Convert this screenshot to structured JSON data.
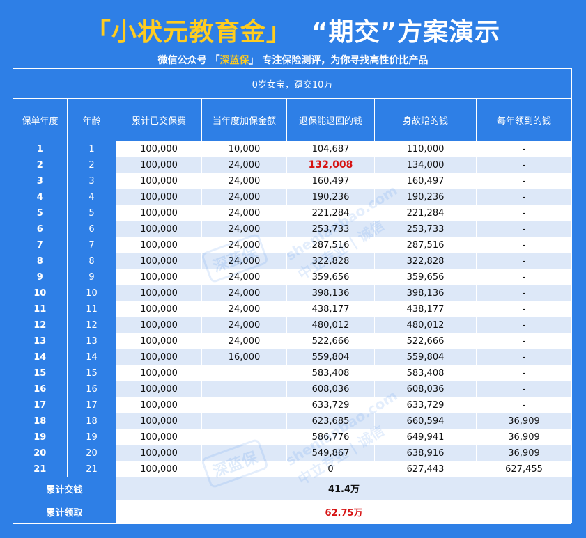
{
  "header": {
    "title_open": "「",
    "title_brand": "小状元教育金",
    "title_close": "」",
    "title_rest": "“期交”方案演示",
    "subtitle_prefix": "微信公众号 「",
    "subtitle_highlight": "深蓝保",
    "subtitle_suffix": "」 专注保险测评，为你寻找高性价比产品"
  },
  "table": {
    "caption": "0岁女宝，趸交10万",
    "columns": [
      "保单年度",
      "年龄",
      "累计已交保费",
      "当年度加保金额",
      "退保能退回的钱",
      "身故赔的钱",
      "每年领到的钱"
    ],
    "rows": [
      [
        "1",
        "1",
        "100,000",
        "10,000",
        "104,687",
        "110,000",
        "-"
      ],
      [
        "2",
        "2",
        "100,000",
        "24,000",
        "132,008",
        "134,000",
        "-"
      ],
      [
        "3",
        "3",
        "100,000",
        "24,000",
        "160,497",
        "160,497",
        "-"
      ],
      [
        "4",
        "4",
        "100,000",
        "24,000",
        "190,236",
        "190,236",
        "-"
      ],
      [
        "5",
        "5",
        "100,000",
        "24,000",
        "221,284",
        "221,284",
        "-"
      ],
      [
        "6",
        "6",
        "100,000",
        "24,000",
        "253,733",
        "253,733",
        "-"
      ],
      [
        "7",
        "7",
        "100,000",
        "24,000",
        "287,516",
        "287,516",
        "-"
      ],
      [
        "8",
        "8",
        "100,000",
        "24,000",
        "322,828",
        "322,828",
        "-"
      ],
      [
        "9",
        "9",
        "100,000",
        "24,000",
        "359,656",
        "359,656",
        "-"
      ],
      [
        "10",
        "10",
        "100,000",
        "24,000",
        "398,136",
        "398,136",
        "-"
      ],
      [
        "11",
        "11",
        "100,000",
        "24,000",
        "438,177",
        "438,177",
        "-"
      ],
      [
        "12",
        "12",
        "100,000",
        "24,000",
        "480,012",
        "480,012",
        "-"
      ],
      [
        "13",
        "13",
        "100,000",
        "24,000",
        "522,666",
        "522,666",
        "-"
      ],
      [
        "14",
        "14",
        "100,000",
        "16,000",
        "559,804",
        "559,804",
        "-"
      ],
      [
        "15",
        "15",
        "100,000",
        "",
        "583,408",
        "583,408",
        "-"
      ],
      [
        "16",
        "16",
        "100,000",
        "",
        "608,036",
        "608,036",
        "-"
      ],
      [
        "17",
        "17",
        "100,000",
        "",
        "633,729",
        "633,729",
        "-"
      ],
      [
        "18",
        "18",
        "100,000",
        "",
        "623,685",
        "660,594",
        "36,909"
      ],
      [
        "19",
        "19",
        "100,000",
        "",
        "586,776",
        "649,941",
        "36,909"
      ],
      [
        "20",
        "20",
        "100,000",
        "",
        "549,867",
        "638,916",
        "36,909"
      ],
      [
        "21",
        "21",
        "100,000",
        "",
        "0",
        "627,443",
        "627,455"
      ]
    ],
    "highlight_cell": {
      "row": 1,
      "col": 4,
      "color": "#d61212"
    },
    "summary": [
      {
        "label": "累计交钱",
        "value": "41.4万"
      },
      {
        "label": "累计领取",
        "value": "62.75万"
      }
    ]
  },
  "watermark": {
    "domain": "shenlanbao.com",
    "slogan": "中立专业 | 诚信",
    "logo": "深蓝保"
  },
  "colors": {
    "background": "#2e7fe6",
    "brand_yellow": "#ffcc1f",
    "alt_row": "#dde8f8",
    "accent_red": "#d61212"
  }
}
